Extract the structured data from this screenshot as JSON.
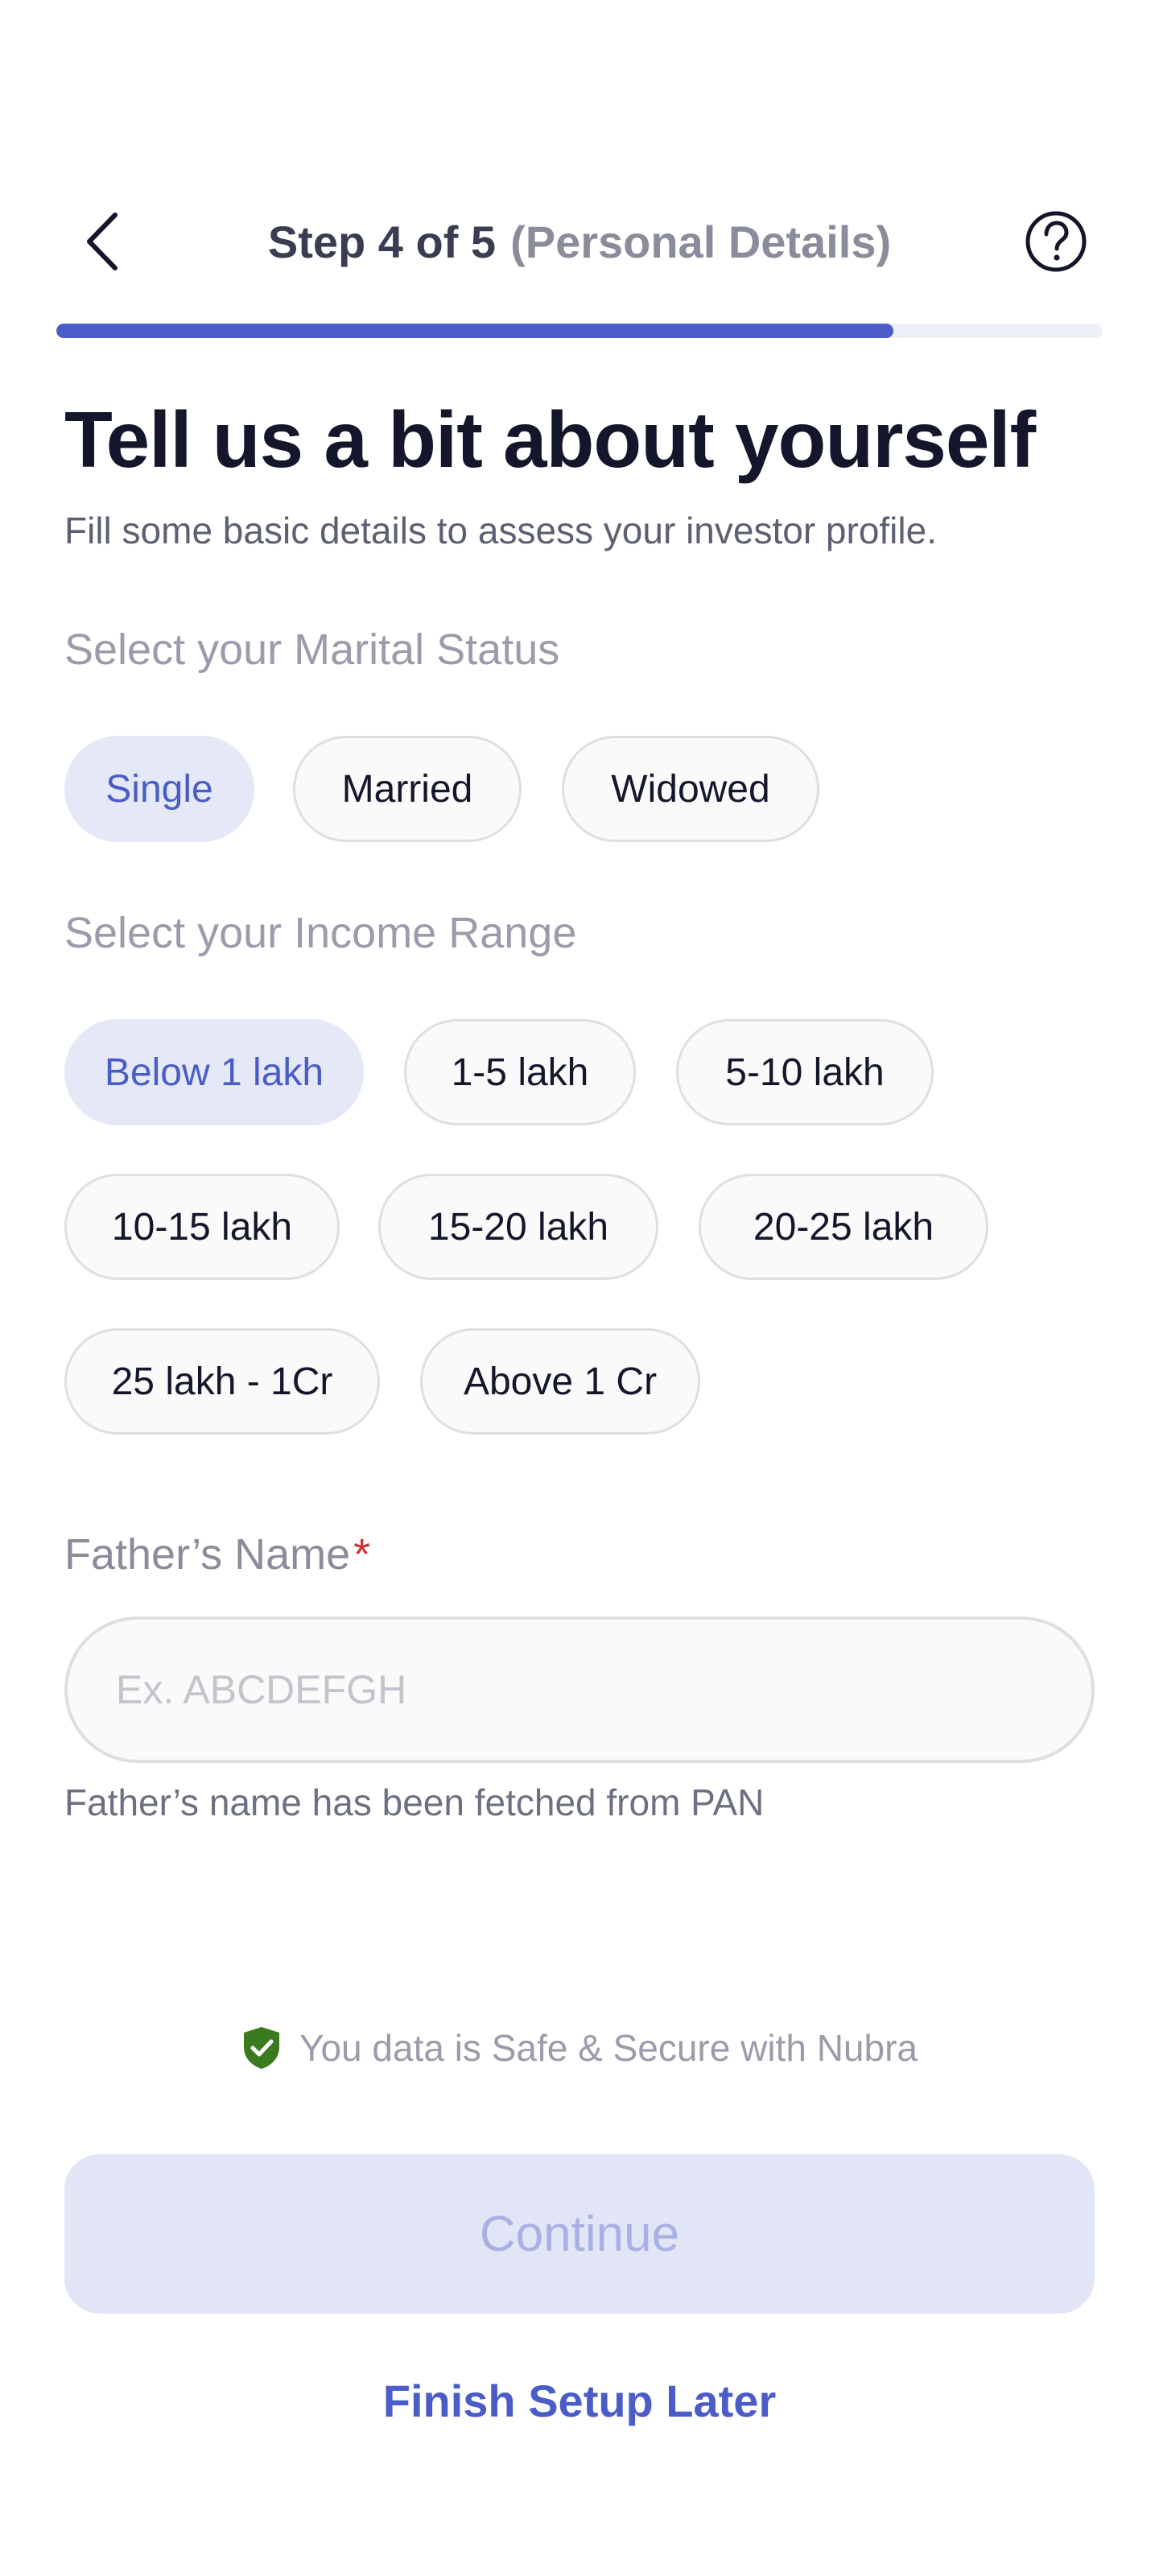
{
  "header": {
    "step": "Step 4 of 5",
    "step_sub": "(Personal Details)",
    "back_icon": "chevron-left-icon",
    "help_icon": "question-circle-icon",
    "progress": 0.8
  },
  "title": "Tell us a bit about yourself",
  "subtitle": "Fill some basic details to assess your investor profile.",
  "marital": {
    "label": "Select your Marital Status",
    "options": [
      "Single",
      "Married",
      "Widowed"
    ],
    "selected": "Single"
  },
  "income": {
    "label": "Select your Income Range",
    "options": [
      "Below 1 lakh",
      "1-5 lakh",
      "5-10 lakh",
      "10-15 lakh",
      "15-20 lakh",
      "20-25 lakh",
      "25 lakh - 1Cr",
      "Above 1 Cr"
    ],
    "selected": "Below 1 lakh"
  },
  "father": {
    "label": "Father’s Name",
    "required_mark": "*",
    "placeholder": "Ex. ABCDEFGH",
    "value": "",
    "helper": "Father’s name has been fetched from PAN"
  },
  "secure": {
    "icon": "shield-check-icon",
    "text": "You data is Safe & Secure with Nubra"
  },
  "continue_label": "Continue",
  "later_label": "Finish Setup Later",
  "colors": {
    "accent": "#4a5cc7",
    "selected_bg": "#e5e8f7",
    "disabled_bg": "#e1e5f6",
    "required": "#d0302c",
    "shield": "#3b7a1e"
  }
}
